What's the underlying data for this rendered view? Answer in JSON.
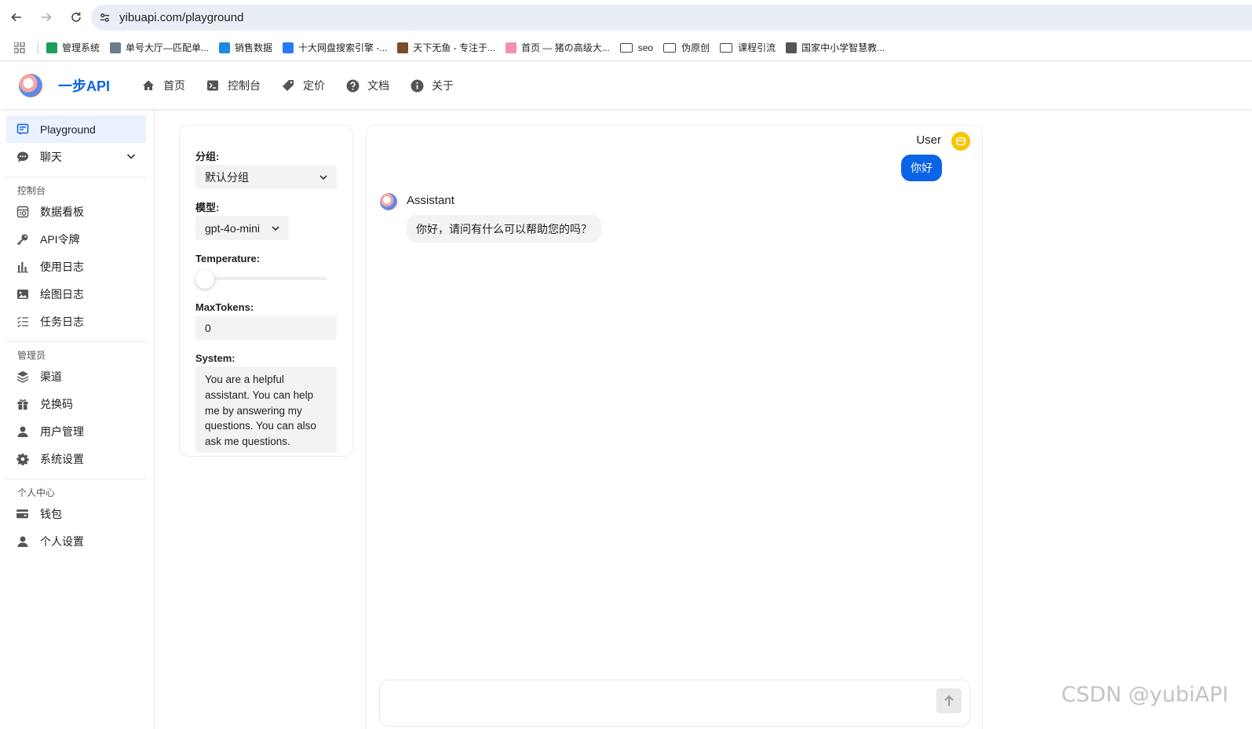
{
  "browser": {
    "url": "yibuapi.com/playground",
    "bookmarks": [
      {
        "label": "管理系统",
        "color": "#1a9f5a"
      },
      {
        "label": "单号大厅—匹配单...",
        "color": "#6a7b8c"
      },
      {
        "label": "销售数据",
        "color": "#1e88e5"
      },
      {
        "label": "十大网盘搜索引擎 -...",
        "color": "#2979ff"
      },
      {
        "label": "天下无鱼 - 专注于...",
        "color": "#7b4a2a"
      },
      {
        "label": "首页 — 猪の高级大...",
        "color": "#f48fb1"
      },
      {
        "label": "seo",
        "folder": true
      },
      {
        "label": "伪原创",
        "folder": true
      },
      {
        "label": "课程引流",
        "folder": true
      },
      {
        "label": "国家中小学智慧教...",
        "color": "#555555"
      }
    ]
  },
  "header": {
    "brand": "一步API",
    "nav": [
      {
        "label": "首页",
        "icon": "home-icon"
      },
      {
        "label": "控制台",
        "icon": "terminal-icon"
      },
      {
        "label": "定价",
        "icon": "tag-icon"
      },
      {
        "label": "文档",
        "icon": "help-icon"
      },
      {
        "label": "关于",
        "icon": "info-icon"
      }
    ]
  },
  "sidebar": {
    "top_items": [
      {
        "label": "Playground",
        "icon": "playground-icon",
        "active": true
      },
      {
        "label": "聊天",
        "icon": "chat-icon"
      }
    ],
    "groups": [
      {
        "title": "控制台",
        "items": [
          {
            "label": "数据看板",
            "icon": "dashboard-icon"
          },
          {
            "label": "API令牌",
            "icon": "key-icon"
          },
          {
            "label": "使用日志",
            "icon": "bar-chart-icon"
          },
          {
            "label": "绘图日志",
            "icon": "image-icon"
          },
          {
            "label": "任务日志",
            "icon": "checklist-icon"
          }
        ]
      },
      {
        "title": "管理员",
        "items": [
          {
            "label": "渠道",
            "icon": "layers-icon"
          },
          {
            "label": "兑换码",
            "icon": "gift-icon"
          },
          {
            "label": "用户管理",
            "icon": "user-icon"
          },
          {
            "label": "系统设置",
            "icon": "gear-icon"
          }
        ]
      },
      {
        "title": "个人中心",
        "items": [
          {
            "label": "钱包",
            "icon": "wallet-icon"
          },
          {
            "label": "个人设置",
            "icon": "user-icon"
          }
        ]
      }
    ]
  },
  "settings": {
    "group_label": "分组:",
    "group_value": "默认分组",
    "model_label": "模型:",
    "model_value": "gpt-4o-mini",
    "temperature_label": "Temperature:",
    "temperature_fraction": 0.0,
    "max_tokens_label": "MaxTokens:",
    "max_tokens_value": "0",
    "system_label": "System:",
    "system_value": "You are a helpful assistant. You can help me by answering my questions. You can also ask me questions."
  },
  "chat": {
    "user_name": "User",
    "user_message": "你好",
    "assistant_name": "Assistant",
    "assistant_message": "你好，请问有什么可以帮助您的吗？",
    "input_placeholder": ""
  },
  "watermark": "CSDN @yubiAPI",
  "colors": {
    "accent": "#0b63e5",
    "user_avatar": "#fbc400"
  }
}
